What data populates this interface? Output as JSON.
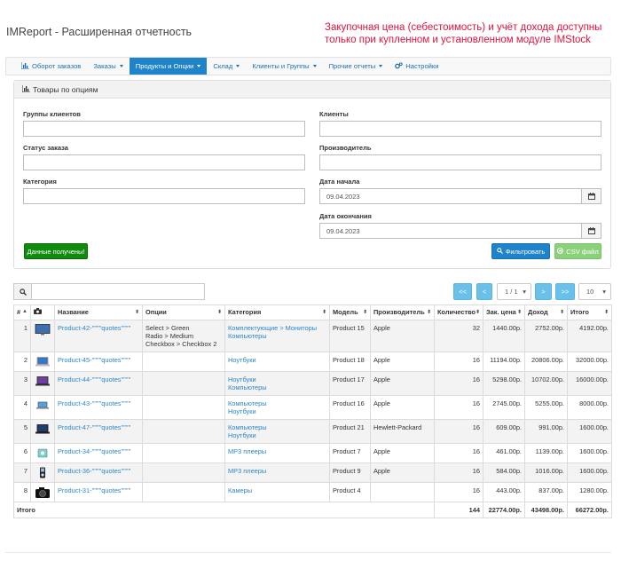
{
  "app_title": "IMReport - Расширенная отчетность",
  "notice": [
    "Закупочная цена (себестоимость) и учёт дохода доступны",
    "только при купленном и установленном модуле IMStock"
  ],
  "nav": [
    {
      "label": "Оборот заказов",
      "icon": "bar-chart-icon",
      "dropdown": false,
      "active": false
    },
    {
      "label": "Заказы",
      "dropdown": true,
      "active": false
    },
    {
      "label": "Продукты и Опции",
      "dropdown": true,
      "active": true
    },
    {
      "label": "Склад",
      "dropdown": true,
      "active": false
    },
    {
      "label": "Клиенты и Группы",
      "dropdown": true,
      "active": false
    },
    {
      "label": "Прочие отчеты",
      "dropdown": true,
      "active": false
    },
    {
      "label": "Настройки",
      "icon": "gears-icon",
      "dropdown": false,
      "active": false
    }
  ],
  "panel": {
    "title": "Товары по опциям",
    "customer_groups_label": "Группы клиентов",
    "customers_label": "Клиенты",
    "order_status_label": "Статус заказа",
    "manufacturer_label": "Производитель",
    "category_label": "Категория",
    "date_start_label": "Дата начала",
    "date_start_value": "09.04.2023",
    "date_end_label": "Дата окончания",
    "date_end_value": "09.04.2023",
    "status_button": "Данные получены!",
    "filter_button": "Фильтровать",
    "csv_button": "CSV файл"
  },
  "pager": {
    "first": "<<",
    "prev": "<",
    "page": "1 / 1",
    "next": ">",
    "last": ">>",
    "per_page": "10"
  },
  "table": {
    "headers": [
      "#",
      "",
      "Название",
      "Опции",
      "Категория",
      "Модель",
      "Производитель",
      "Количество",
      "Зак. цена",
      "Доход",
      "Итого"
    ],
    "rows": [
      {
        "n": "1",
        "image": "monitor",
        "name": "Product-42-\"'\"'\"quotes\"'\"'\"",
        "options": "Select > Green\nRadio > Medium\nCheckbox > Checkbox 2",
        "category": "Комплектующие > Мониторы\nКомпьютеры",
        "model": "Product 15",
        "manufacturer": "Apple",
        "qty": "32",
        "cost": "1440.00р.",
        "income": "2752.00р.",
        "total": "4192.00р."
      },
      {
        "n": "2",
        "image": "laptop-silver",
        "name": "Product-45-\"'\"'\"quotes\"'\"'\"",
        "options": "",
        "category": "Ноутбуки",
        "model": "Product 18",
        "manufacturer": "Apple",
        "qty": "16",
        "cost": "11194.00р.",
        "income": "20806.00р.",
        "total": "32000.00р."
      },
      {
        "n": "3",
        "image": "laptop-black",
        "name": "Product-44-\"'\"'\"quotes\"'\"'\"",
        "options": "",
        "category": "Ноутбуки\nКомпьютеры",
        "model": "Product 17",
        "manufacturer": "Apple",
        "qty": "16",
        "cost": "5298.00р.",
        "income": "10702.00р.",
        "total": "16000.00р."
      },
      {
        "n": "4",
        "image": "laptop-thin",
        "name": "Product-43-\"'\"'\"quotes\"'\"'\"",
        "options": "",
        "category": "Компьютеры\nНоутбуки",
        "model": "Product 16",
        "manufacturer": "Apple",
        "qty": "16",
        "cost": "2745.00р.",
        "income": "5255.00р.",
        "total": "8000.00р."
      },
      {
        "n": "5",
        "image": "laptop-dark",
        "name": "Product-47-\"'\"'\"quotes\"'\"'\"",
        "options": "",
        "category": "Компьютеры\nНоутбуки",
        "model": "Product 21",
        "manufacturer": "Hewlett-Packard",
        "qty": "16",
        "cost": "609.00р.",
        "income": "991.00р.",
        "total": "1600.00р."
      },
      {
        "n": "6",
        "image": "mp3-player",
        "name": "Product-34-\"'\"'\"quotes\"'\"'\"",
        "options": "",
        "category": "MP3 плееры",
        "model": "Product 7",
        "manufacturer": "Apple",
        "qty": "16",
        "cost": "461.00р.",
        "income": "1139.00р.",
        "total": "1600.00р."
      },
      {
        "n": "7",
        "image": "ipod",
        "name": "Product-36-\"'\"'\"quotes\"'\"'\"",
        "options": "",
        "category": "MP3 плееры",
        "model": "Product 9",
        "manufacturer": "Apple",
        "qty": "16",
        "cost": "584.00р.",
        "income": "1016.00р.",
        "total": "1600.00р."
      },
      {
        "n": "8",
        "image": "camera",
        "name": "Product-31-\"'\"'\"quotes\"'\"'\"",
        "options": "",
        "category": "Камеры",
        "model": "Product 4",
        "manufacturer": "",
        "qty": "16",
        "cost": "443.00р.",
        "income": "837.00р.",
        "total": "1280.00р."
      }
    ],
    "footer": {
      "label": "Итого",
      "qty": "144",
      "cost": "22774.00р.",
      "income": "43498.00р.",
      "total": "66272.00р."
    }
  }
}
